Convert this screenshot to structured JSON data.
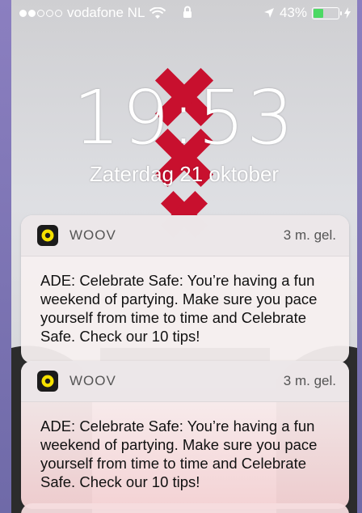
{
  "status_bar": {
    "carrier": "vodafone NL",
    "battery_percent": "43%",
    "battery_level": 0.43,
    "signal_bars_filled": 2,
    "signal_bars_total": 5,
    "battery_color": "#4cd964"
  },
  "lock_screen": {
    "time": "19:53",
    "date": "Zaterdag 21 oktober"
  },
  "notifications": [
    {
      "app": "WOOV",
      "when": "3 m. gel.",
      "message": "ADE: Celebrate Safe: You’re having a fun weekend of partying. Make sure you pace yourself from time to time and Celebrate Safe. Check our 10 tips!",
      "icon": "woov-app-icon"
    },
    {
      "app": "WOOV",
      "when": "3 m. gel.",
      "message": "ADE: Celebrate Safe: You’re having a fun weekend of partying. Make sure you pace yourself from time to time and Celebrate Safe. Check our 10 tips!",
      "icon": "woov-app-icon"
    }
  ],
  "icons": {
    "wifi": "wifi-icon",
    "lock": "lock-icon",
    "location": "location-arrow-icon",
    "charging": "charging-bolt-icon"
  }
}
